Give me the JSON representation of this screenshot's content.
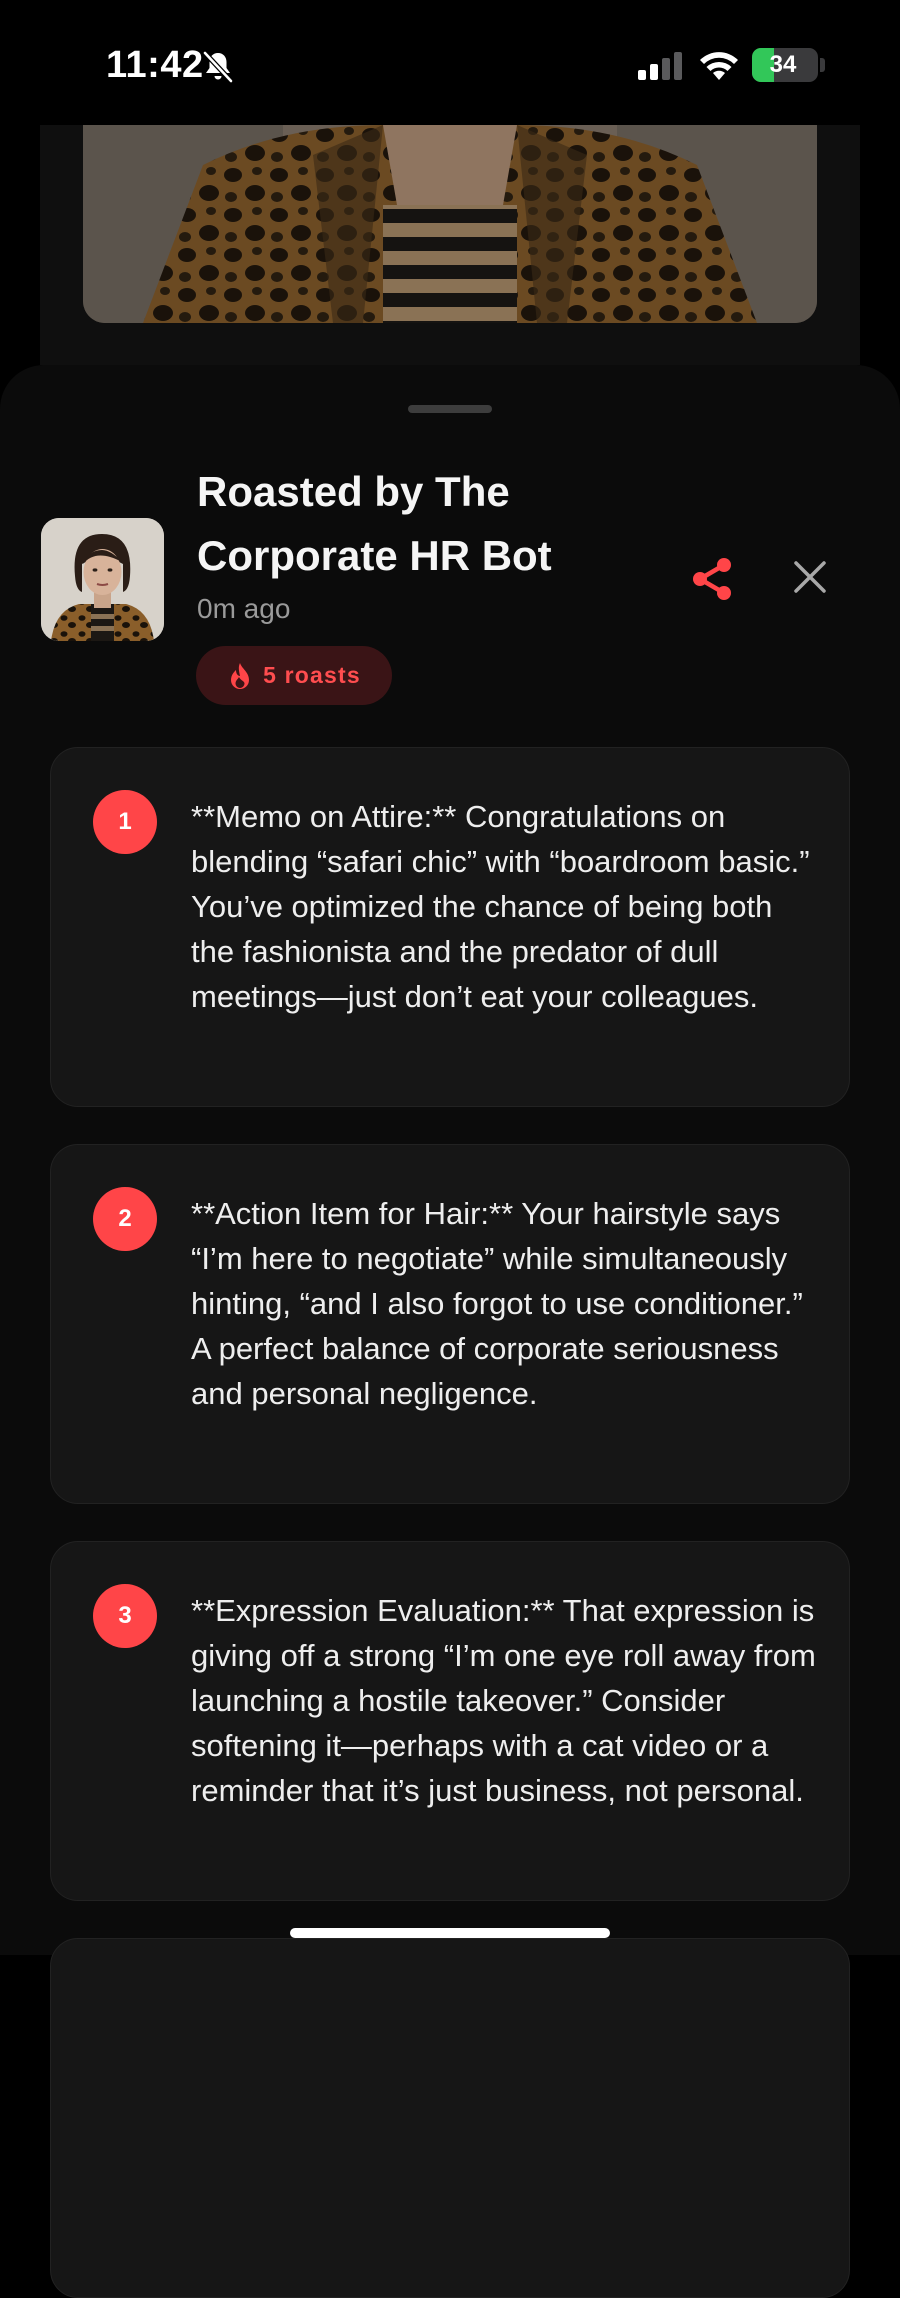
{
  "status_bar": {
    "time": "11:42",
    "battery": "34",
    "battery_level": 0.34,
    "icons": [
      "bell-slash-icon",
      "cellular-signal-icon",
      "wifi-icon",
      "battery-charging-icon"
    ]
  },
  "sheet": {
    "title": "Roasted by The Corporate HR Bot",
    "time_ago": "0m ago",
    "badge": "5 roasts",
    "icons": {
      "badge": "flame-icon",
      "share": "share-icon",
      "close": "close-icon"
    }
  },
  "roasts": [
    {
      "number": "1",
      "text": "**Memo on Attire:** Congratulations on blending “safari chic” with “boardroom basic.” You’ve optimized the chance of being both the fashionista and the predator of dull meetings—just don’t eat your colleagues."
    },
    {
      "number": "2",
      "text": "**Action Item for Hair:** Your hairstyle says “I’m here to negotiate” while simultaneously hinting, “and I also forgot to use conditioner.” A perfect balance of corporate seriousness and personal negligence."
    },
    {
      "number": "3",
      "text": "**Expression Evaluation:** That expression is giving off a strong “I’m one eye roll away from launching a hostile takeover.” Consider softening it—perhaps with a cat video or a reminder that it’s just business, not personal."
    }
  ],
  "colors": {
    "accent": "#ff4548",
    "badge_bg": "#3a1416",
    "card_bg": "#161616",
    "sheet_bg": "#0b0b0b"
  }
}
